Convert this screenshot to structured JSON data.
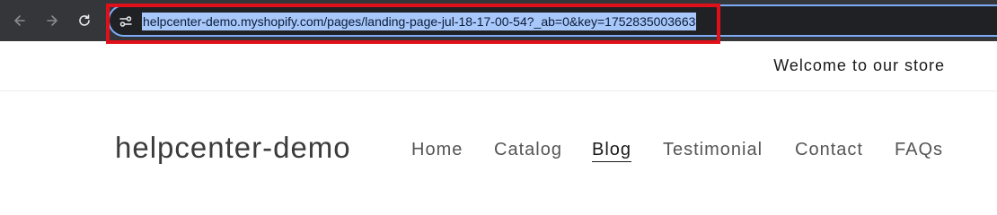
{
  "browser": {
    "url": "helpcenter-demo.myshopify.com/pages/landing-page-jul-18-17-00-54?_ab=0&key=1752835003663",
    "icons": [
      "arrow-left-icon",
      "arrow-right-icon",
      "reload-icon",
      "site-settings-icon"
    ]
  },
  "announcement": {
    "text": "Welcome to our store"
  },
  "header": {
    "store_name": "helpcenter-demo",
    "menu": [
      {
        "label": "Home"
      },
      {
        "label": "Catalog"
      },
      {
        "label": "Blog",
        "active": true
      },
      {
        "label": "Testimonial"
      },
      {
        "label": "Contact"
      },
      {
        "label": "FAQs"
      }
    ]
  },
  "colors": {
    "chrome_bg": "#35363a",
    "highlight": "#e0101a",
    "url_selection": "#a8c7fa"
  }
}
